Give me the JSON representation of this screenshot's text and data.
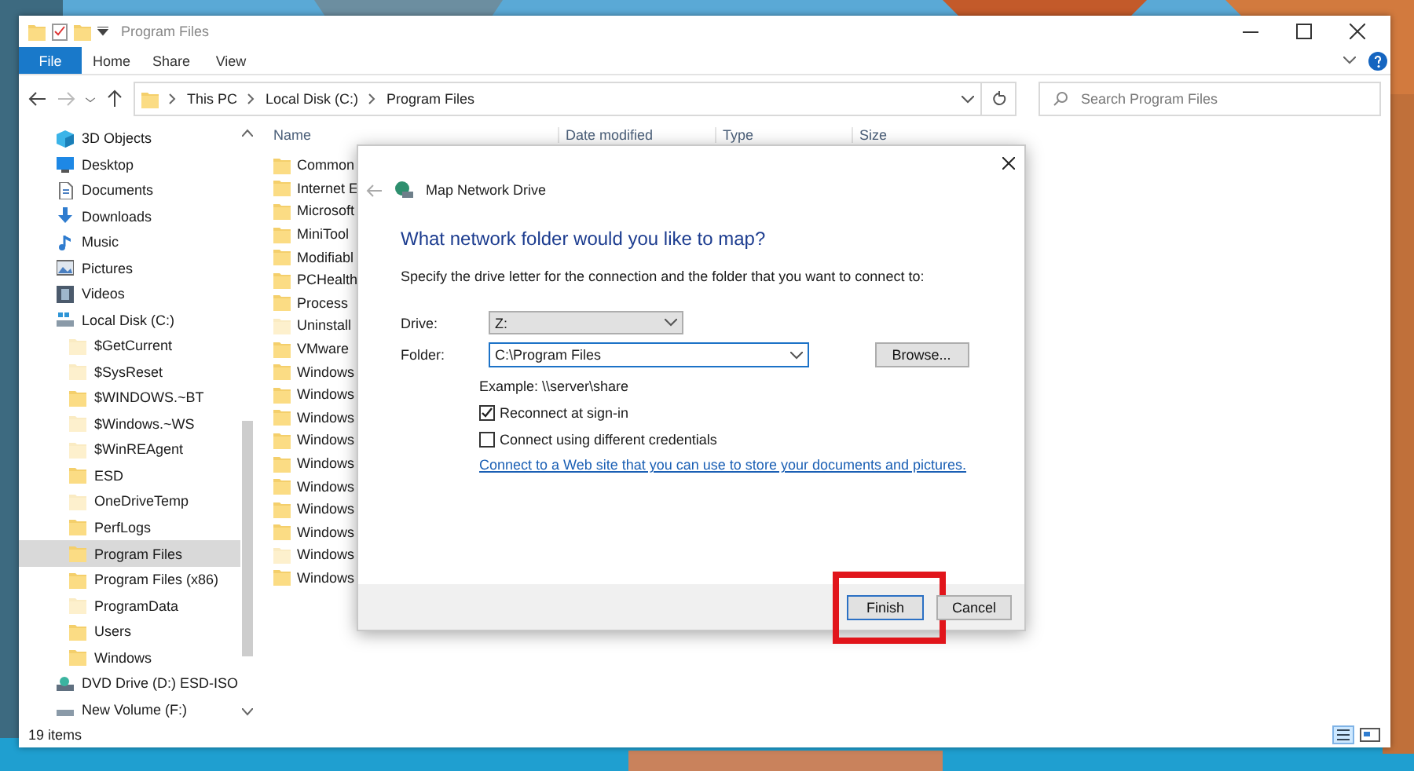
{
  "window": {
    "title": "Program Files"
  },
  "ribbon_tabs": [
    {
      "label": "File",
      "selected": true
    },
    {
      "label": "Home",
      "selected": false
    },
    {
      "label": "Share",
      "selected": false
    },
    {
      "label": "View",
      "selected": false
    }
  ],
  "address": {
    "crumbs": [
      "This PC",
      "Local Disk (C:)",
      "Program Files"
    ]
  },
  "search": {
    "placeholder": "Search Program Files"
  },
  "sidebar": {
    "items": [
      {
        "label": "3D Objects",
        "kind": "objects3d",
        "selected": false
      },
      {
        "label": "Desktop",
        "kind": "desktop",
        "selected": false
      },
      {
        "label": "Documents",
        "kind": "documents",
        "selected": false
      },
      {
        "label": "Downloads",
        "kind": "downloads",
        "selected": false
      },
      {
        "label": "Music",
        "kind": "music",
        "selected": false
      },
      {
        "label": "Pictures",
        "kind": "pictures",
        "selected": false
      },
      {
        "label": "Videos",
        "kind": "videos",
        "selected": false
      },
      {
        "label": "Local Disk (C:)",
        "kind": "disk",
        "selected": false,
        "children": [
          {
            "label": "$GetCurrent",
            "kind": "folder",
            "hidden": true,
            "selected": false
          },
          {
            "label": "$SysReset",
            "kind": "folder",
            "hidden": true,
            "selected": false
          },
          {
            "label": "$WINDOWS.~BT",
            "kind": "folder",
            "hidden": false,
            "selected": false
          },
          {
            "label": "$Windows.~WS",
            "kind": "folder",
            "hidden": true,
            "selected": false
          },
          {
            "label": "$WinREAgent",
            "kind": "folder",
            "hidden": true,
            "selected": false
          },
          {
            "label": "ESD",
            "kind": "folder",
            "hidden": false,
            "selected": false
          },
          {
            "label": "OneDriveTemp",
            "kind": "folder",
            "hidden": true,
            "selected": false
          },
          {
            "label": "PerfLogs",
            "kind": "folder",
            "hidden": false,
            "selected": false
          },
          {
            "label": "Program Files",
            "kind": "folder",
            "hidden": false,
            "selected": true
          },
          {
            "label": "Program Files (x86)",
            "kind": "folder",
            "hidden": false,
            "selected": false
          },
          {
            "label": "ProgramData",
            "kind": "folder",
            "hidden": true,
            "selected": false
          },
          {
            "label": "Users",
            "kind": "folder",
            "hidden": false,
            "selected": false
          },
          {
            "label": "Windows",
            "kind": "folder",
            "hidden": false,
            "selected": false
          }
        ]
      },
      {
        "label": "DVD Drive (D:) ESD-ISO",
        "kind": "dvd",
        "selected": false
      },
      {
        "label": "New Volume (F:)",
        "kind": "drive",
        "selected": false
      }
    ]
  },
  "file_list": {
    "columns": [
      "Name",
      "Date modified",
      "Type",
      "Size"
    ],
    "rows": [
      {
        "name": "Common",
        "hidden": false
      },
      {
        "name": "Internet E",
        "hidden": false
      },
      {
        "name": "Microsoft",
        "hidden": false
      },
      {
        "name": "MiniTool",
        "hidden": false
      },
      {
        "name": "Modifiabl",
        "hidden": false
      },
      {
        "name": "PCHealth",
        "hidden": false
      },
      {
        "name": "Process",
        "hidden": false
      },
      {
        "name": "Uninstall",
        "hidden": true
      },
      {
        "name": "VMware",
        "hidden": false
      },
      {
        "name": "Windows",
        "hidden": false
      },
      {
        "name": "Windows",
        "hidden": false
      },
      {
        "name": "Windows",
        "hidden": false
      },
      {
        "name": "Windows",
        "hidden": false
      },
      {
        "name": "Windows",
        "hidden": false
      },
      {
        "name": "Windows",
        "hidden": false
      },
      {
        "name": "Windows",
        "hidden": false
      },
      {
        "name": "Windows",
        "hidden": false
      },
      {
        "name": "Windows",
        "hidden": true
      },
      {
        "name": "Windows",
        "hidden": false
      }
    ]
  },
  "status_bar": {
    "count": "19 items"
  },
  "dialog": {
    "title": "Map Network Drive",
    "heading": "What network folder would you like to map?",
    "description": "Specify the drive letter for the connection and the folder that you want to connect to:",
    "drive": {
      "label": "Drive:",
      "value": "Z:"
    },
    "folder": {
      "label": "Folder:",
      "value": "C:\\Program Files",
      "browse": "Browse..."
    },
    "example": "Example: \\\\server\\share",
    "options": [
      {
        "label": "Reconnect at sign-in",
        "checked": true
      },
      {
        "label": "Connect using different credentials",
        "checked": false
      }
    ],
    "link": "Connect to a Web site that you can use to store your documents and pictures.",
    "buttons": [
      {
        "label": "Finish",
        "highlighted": true
      },
      {
        "label": "Cancel",
        "highlighted": false
      }
    ]
  }
}
